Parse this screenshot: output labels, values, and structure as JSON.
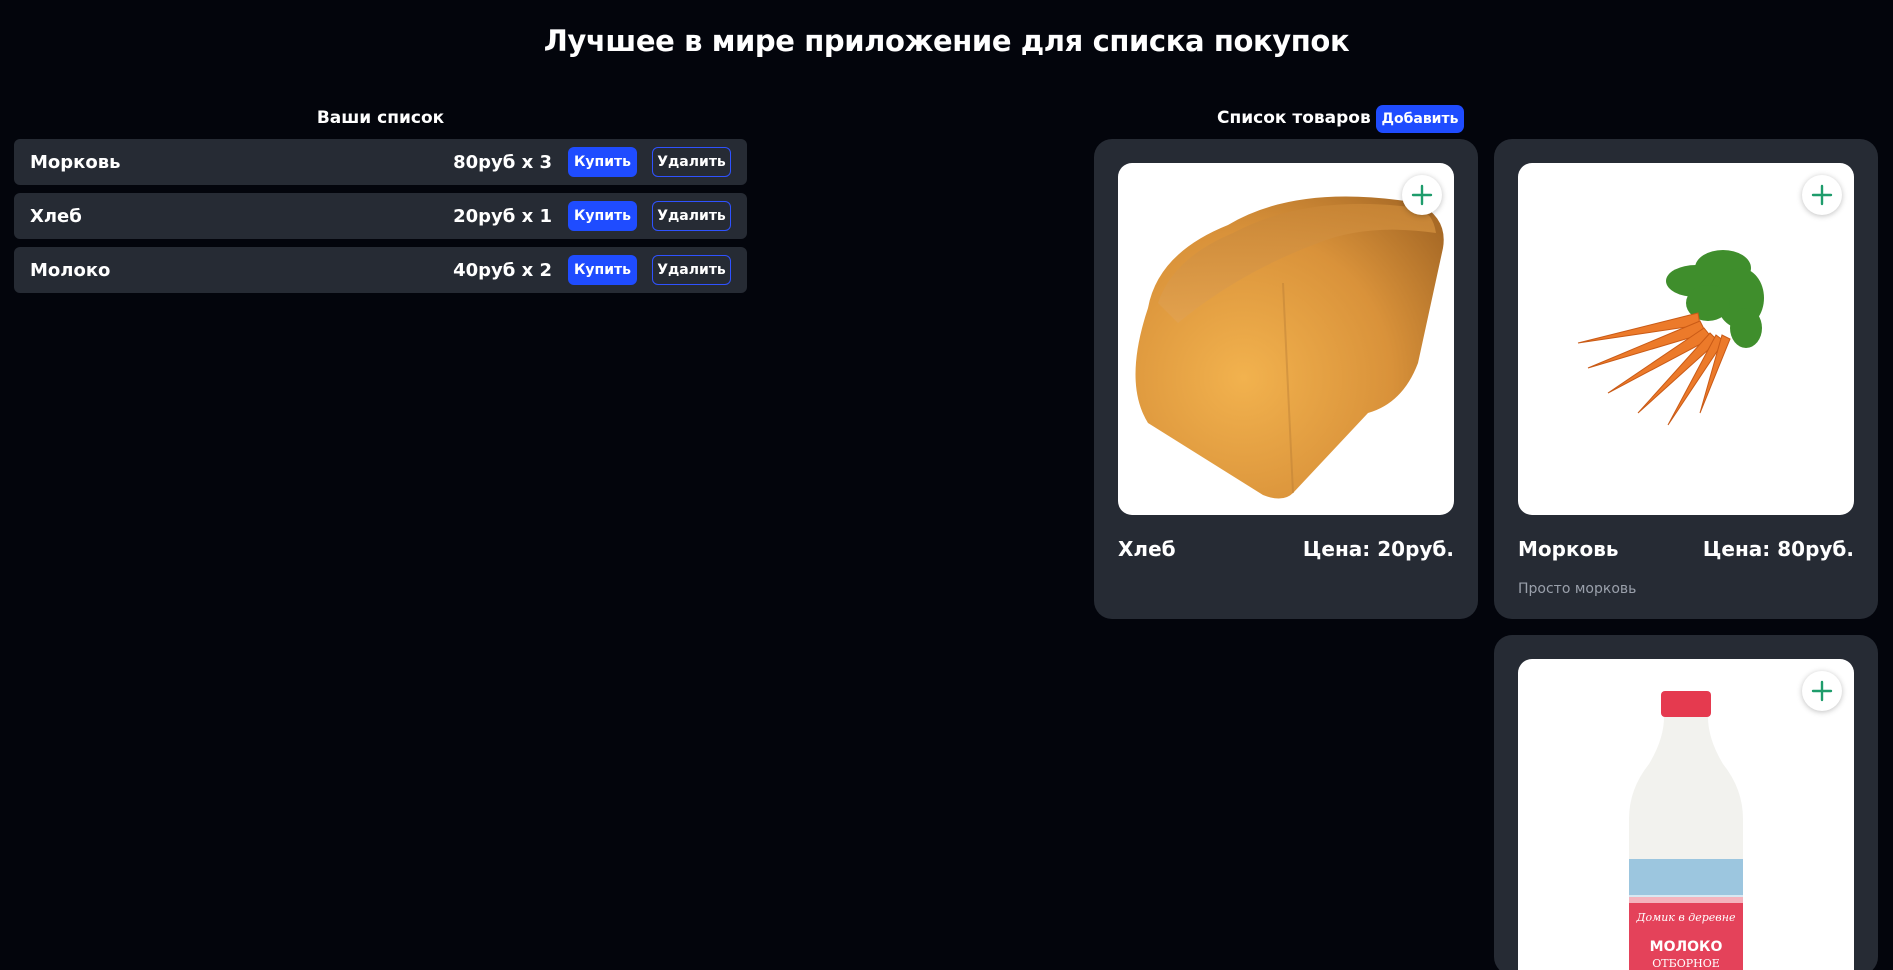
{
  "title": "Лучшее в мире приложение для списка покупок",
  "shopping_list": {
    "heading": "Ваши список",
    "buy_label": "Купить",
    "delete_label": "Удалить",
    "items": [
      {
        "name": "Морковь",
        "price": "80руб x 3"
      },
      {
        "name": "Хлеб",
        "price": "20руб x 1"
      },
      {
        "name": "Молоко",
        "price": "40руб x 2"
      }
    ]
  },
  "catalog": {
    "heading": "Список товаров",
    "add_label": "Добавить",
    "products": [
      {
        "name": "Хлеб",
        "price": "Цена: 20руб.",
        "description": "",
        "image": "bread-image"
      },
      {
        "name": "Морковь",
        "price": "Цена: 80руб.",
        "description": "Просто морковь",
        "image": "carrot-image"
      },
      {
        "name": "",
        "price": "",
        "description": "",
        "image": "milk-bottle-image",
        "image_text": [
          "Домик в деревне",
          "МОЛОКО",
          "ОТБОРНОЕ"
        ]
      }
    ]
  },
  "colors": {
    "background": "#03050c",
    "panel": "#262b34",
    "accent": "#1f4cff",
    "plus": "#1e9c6b"
  },
  "icons": {
    "add_to_list": "plus-icon"
  }
}
